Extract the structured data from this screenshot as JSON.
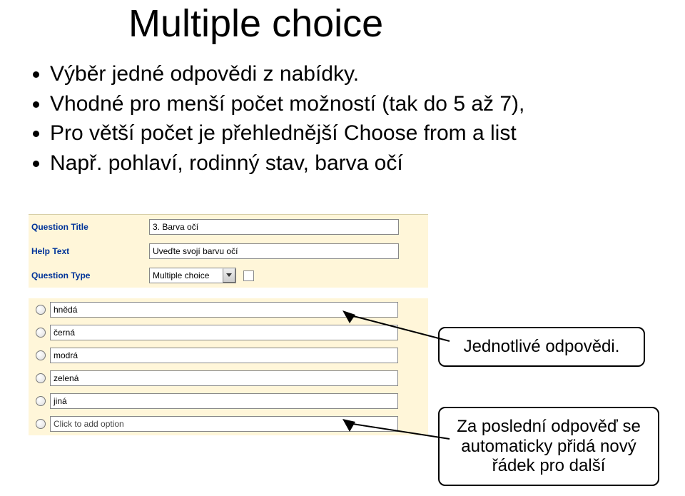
{
  "title": "Multiple choice",
  "bullets": [
    "Výběr jedné odpovědi z nabídky.",
    "Vhodné pro menší počet možností (tak do 5 až 7),",
    "Pro větší počet je přehlednější Choose from a list",
    "Např. pohlaví, rodinný stav, barva očí"
  ],
  "form": {
    "question_title_label": "Question Title",
    "question_title_value": "3. Barva očí",
    "help_text_label": "Help Text",
    "help_text_value": "Uveďte svojí barvu očí",
    "question_type_label": "Question Type",
    "question_type_value": "Multiple choice"
  },
  "options": [
    {
      "value": "hnědá",
      "placeholder": false
    },
    {
      "value": "černá",
      "placeholder": false
    },
    {
      "value": "modrá",
      "placeholder": false
    },
    {
      "value": "zelená",
      "placeholder": false
    },
    {
      "value": "jiná",
      "placeholder": false
    },
    {
      "value": "Click to add option",
      "placeholder": true
    }
  ],
  "callouts": {
    "c1": "Jednotlivé odpovědi.",
    "c2": "Za poslední odpověď se automaticky přidá nový řádek pro další"
  }
}
